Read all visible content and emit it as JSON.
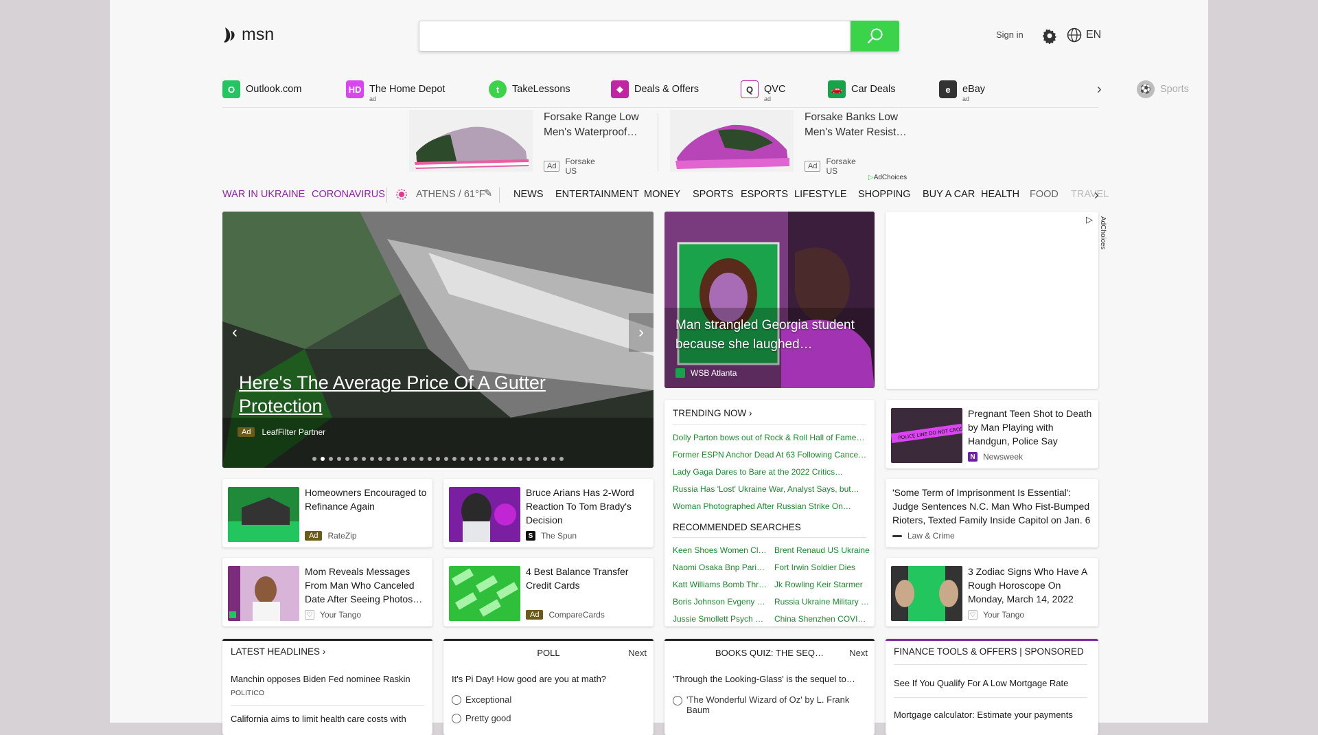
{
  "header": {
    "logo_text": "msn",
    "search_placeholder": "",
    "sign_in": "Sign in",
    "language": "EN"
  },
  "quick_links": [
    {
      "label": "Outlook.com",
      "ad": ""
    },
    {
      "label": "The Home Depot",
      "ad": "ad"
    },
    {
      "label": "TakeLessons",
      "ad": ""
    },
    {
      "label": "Deals & Offers",
      "ad": ""
    },
    {
      "label": "QVC",
      "ad": "ad"
    },
    {
      "label": "Car Deals",
      "ad": ""
    },
    {
      "label": "eBay",
      "ad": "ad"
    },
    {
      "label": "Sports",
      "ad": ""
    }
  ],
  "shoe_ads": [
    {
      "title": "Forsake Range Low Men's Waterproof…",
      "ad": "Ad",
      "source": "Forsake US"
    },
    {
      "title": "Forsake Banks Low Men's Water Resist…",
      "ad": "Ad",
      "source": "Forsake US"
    }
  ],
  "adchoices": "AdChoices",
  "nav": {
    "war": "WAR IN UKRAINE",
    "corona": "CORONAVIRUS",
    "weather": "ATHENS / 61°F",
    "items": [
      "NEWS",
      "ENTERTAINMENT",
      "MONEY",
      "SPORTS",
      "ESPORTS",
      "LIFESTYLE",
      "SHOPPING",
      "BUY A CAR",
      "HEALTH",
      "FOOD",
      "TRAVEL"
    ]
  },
  "hero": {
    "title": "Here's The Average Price Of A Gutter Protection",
    "ad": "Ad",
    "source": "LeafFilter Partner"
  },
  "story2": {
    "title": "Man strangled Georgia student because she laughed…",
    "source": "WSB Atlanta"
  },
  "trending": {
    "heading": "TRENDING NOW",
    "items": [
      "Dolly Parton bows out of Rock & Roll Hall of Fame…",
      "Former ESPN Anchor Dead At 63 Following Cancer…",
      "Lady Gaga Dares to Bare at the 2022 Critics…",
      "Russia Has 'Lost' Ukraine War, Analyst Says, but…",
      "Woman Photographed After Russian Strike On…"
    ],
    "rec_heading": "RECOMMENDED SEARCHES",
    "rec_left": [
      "Keen Shoes Women Clea…",
      "Naomi Osaka Bnp Pariba…",
      "Katt Williams Bomb Threat",
      "Boris Johnson Evgeny Le…",
      "Jussie Smollett Psych Wa…"
    ],
    "rec_right": [
      "Brent Renaud US Ukraine",
      "Fort Irwin Soldier Dies",
      "Jk Rowling Keir Starmer",
      "Russia Ukraine Military …",
      "China Shenzhen COVID…"
    ]
  },
  "cards": [
    {
      "title": "Homeowners Encouraged to Refinance Again",
      "ad": "Ad",
      "source": "RateZip"
    },
    {
      "title": "Bruce Arians Has 2-Word Reaction To Tom Brady's Decision",
      "ad": "",
      "source": "The Spun"
    },
    {
      "title": "Mom Reveals Messages From Man Who Canceled Date After Seeing Photos…",
      "ad": "",
      "source": "Your Tango"
    },
    {
      "title": "4 Best Balance Transfer Credit Cards",
      "ad": "Ad",
      "source": "CompareCards"
    },
    {
      "title": "Pregnant Teen Shot to Death by Man Playing with Handgun, Police Say",
      "ad": "",
      "source": "Newsweek"
    },
    {
      "title": "'Some Term of Imprisonment Is Essential': Judge Sentences N.C. Man Who Fist-Bumped Rioters, Texted Family Inside Capitol on Jan. 6",
      "ad": "",
      "source": "Law & Crime"
    },
    {
      "title": "3 Zodiac Signs Who Have A Rough Horoscope On Monday, March 14, 2022",
      "ad": "",
      "source": "Your Tango"
    }
  ],
  "bottom": {
    "headlines_title": "LATEST HEADLINES",
    "headline1": "Manchin opposes Biden Fed nominee Raskin",
    "headline1_src": "POLITICO",
    "headline2": "California aims to limit health care costs with",
    "poll_title": "POLL",
    "next": "Next",
    "poll_q": "It's Pi Day! How good are you at math?",
    "poll_opts": [
      "Exceptional",
      "Pretty good"
    ],
    "quiz_title": "BOOKS QUIZ: THE SEQ…",
    "quiz_q": "'Through the Looking-Glass' is the sequel to…",
    "quiz_opt1": "'The Wonderful Wizard of Oz' by L. Frank Baum",
    "finance_title": "FINANCE TOOLS & OFFERS | SPONSORED",
    "fin1": "See If You Qualify For A Low Mortgage Rate",
    "fin2": "Mortgage calculator: Estimate your payments"
  },
  "colors": {
    "accent": "#3bd34a",
    "nav_hot": "#8e24aa",
    "link_green": "#1b8b2d"
  }
}
